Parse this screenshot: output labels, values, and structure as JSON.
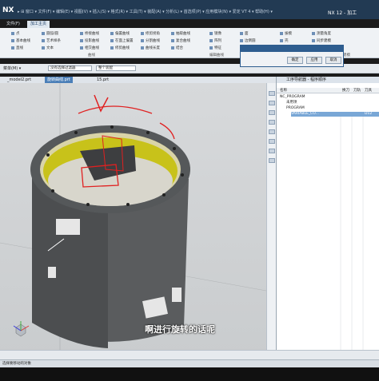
{
  "app": {
    "logo": "NX",
    "title": "NX 12 - 加工",
    "quick_access": "▸ ⊞ 窗口 ▾ 文件(F) ▾ 编辑(E) ▾ 视图(V) ▾ 插入(S) ▾ 格式(R) ▾ 工具(T) ▾ 装配(A) ▾ 分析(L) ▾ 首选项(P) ▾ 应用模块(N) ▾ 爱定 VT 4 ▾ 帮助(H) ▾"
  },
  "tabs": [
    {
      "label": "文件(F)"
    },
    {
      "label": "加工主页"
    }
  ],
  "ribbon": {
    "items": [
      "点",
      "基本曲线",
      "直线",
      "圆弧/圆",
      "艺术样条",
      "文本",
      "桥接曲线",
      "投影曲线",
      "相交曲线",
      "偏置曲线",
      "在面上偏置",
      "修剪曲线",
      "修剪拐角",
      "分割曲线",
      "曲线长度",
      "抽取曲线",
      "复合曲线",
      "结合",
      "镜像",
      "阵列",
      "特征",
      "面",
      "边倒圆",
      "倒斜角",
      "拔模",
      "壳",
      "测量距离",
      "测量角度",
      "同步建模"
    ],
    "groups": [
      "曲线",
      "编辑曲线",
      "更多",
      "同步建模"
    ]
  },
  "menu": {
    "label": "菜单(M) ▾"
  },
  "selection": {
    "filter": "没有选择过滤器",
    "scope": "整个装配"
  },
  "doc_tabs": [
    {
      "label": "_model2.prt"
    },
    {
      "label": "旋转曲线.prt"
    },
    {
      "label": "15.prt"
    }
  ],
  "dialog": {
    "title": "",
    "buttons": [
      "确定",
      "应用",
      "取消"
    ]
  },
  "navigator": {
    "title": "工序导航器 - 程序顺序",
    "columns": [
      "名称",
      "换刀",
      "刀轨",
      "刀具"
    ],
    "rows": [
      {
        "name": "NC_PROGRAM",
        "indent": 0
      },
      {
        "name": "未用项",
        "indent": 1
      },
      {
        "name": "PROGRAM",
        "indent": 1
      },
      {
        "name": "VARIABLE_CO...",
        "indent": 2,
        "tool": "D12",
        "selected": true
      }
    ]
  },
  "subtitle": "啊进行旋转的话呢",
  "status": "选择要移动的对象"
}
